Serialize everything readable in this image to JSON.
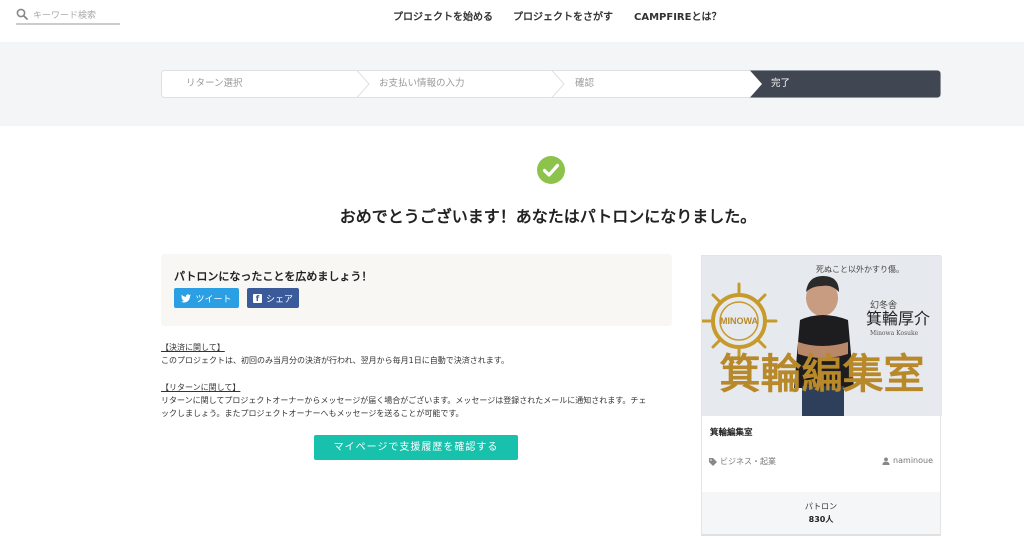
{
  "header": {
    "search_placeholder": "キーワード検索",
    "nav": [
      "プロジェクトを始める",
      "プロジェクトをさがす",
      "CAMPFIREとは？"
    ]
  },
  "steps": [
    "リターン選択",
    "お支払い情報の入力",
    "確認",
    "完了"
  ],
  "active_step": 3,
  "main": {
    "congrats": "おめでとうございます！あなたはパトロンになりました。",
    "share": {
      "title": "パトロンになったことを広めましょう！",
      "tweet": "ツイート",
      "facebook": "シェア"
    },
    "payment": {
      "head": "【決済に関して】",
      "body": "このプロジェクトは、初回のみ当月分の決済が行われ、翌月から毎月1日に自動で決済されます。"
    },
    "returns": {
      "head": "【リターンに関して】",
      "body1": "リターンに関してプロジェクトオーナーからメッセージが届く場合がございます。メッセージは登録されたメールに通知されます。チェ",
      "body2": "ックしましょう。またプロジェクトオーナーへもメッセージを送ることが可能です。"
    },
    "mypage_button": "マイページで支援履歴を確認する"
  },
  "card": {
    "image_caption": "死ぬこと以外かすり傷。",
    "image_publisher": "幻冬舎",
    "image_name": "箕輪厚介",
    "image_name_roman": "Minowa Kosuke",
    "image_logo": "MINOWA",
    "image_banner": "箕輪編集室",
    "title": "箕輪編集室",
    "category": "ビジネス・起業",
    "owner": "naminoue",
    "patron_label": "パトロン",
    "patron_count": "830人"
  },
  "colors": {
    "accent": "#17c1ac",
    "twitter": "#2a9fe3",
    "facebook": "#3b5a9a",
    "success": "#8cc34b",
    "active_step": "#404652"
  }
}
